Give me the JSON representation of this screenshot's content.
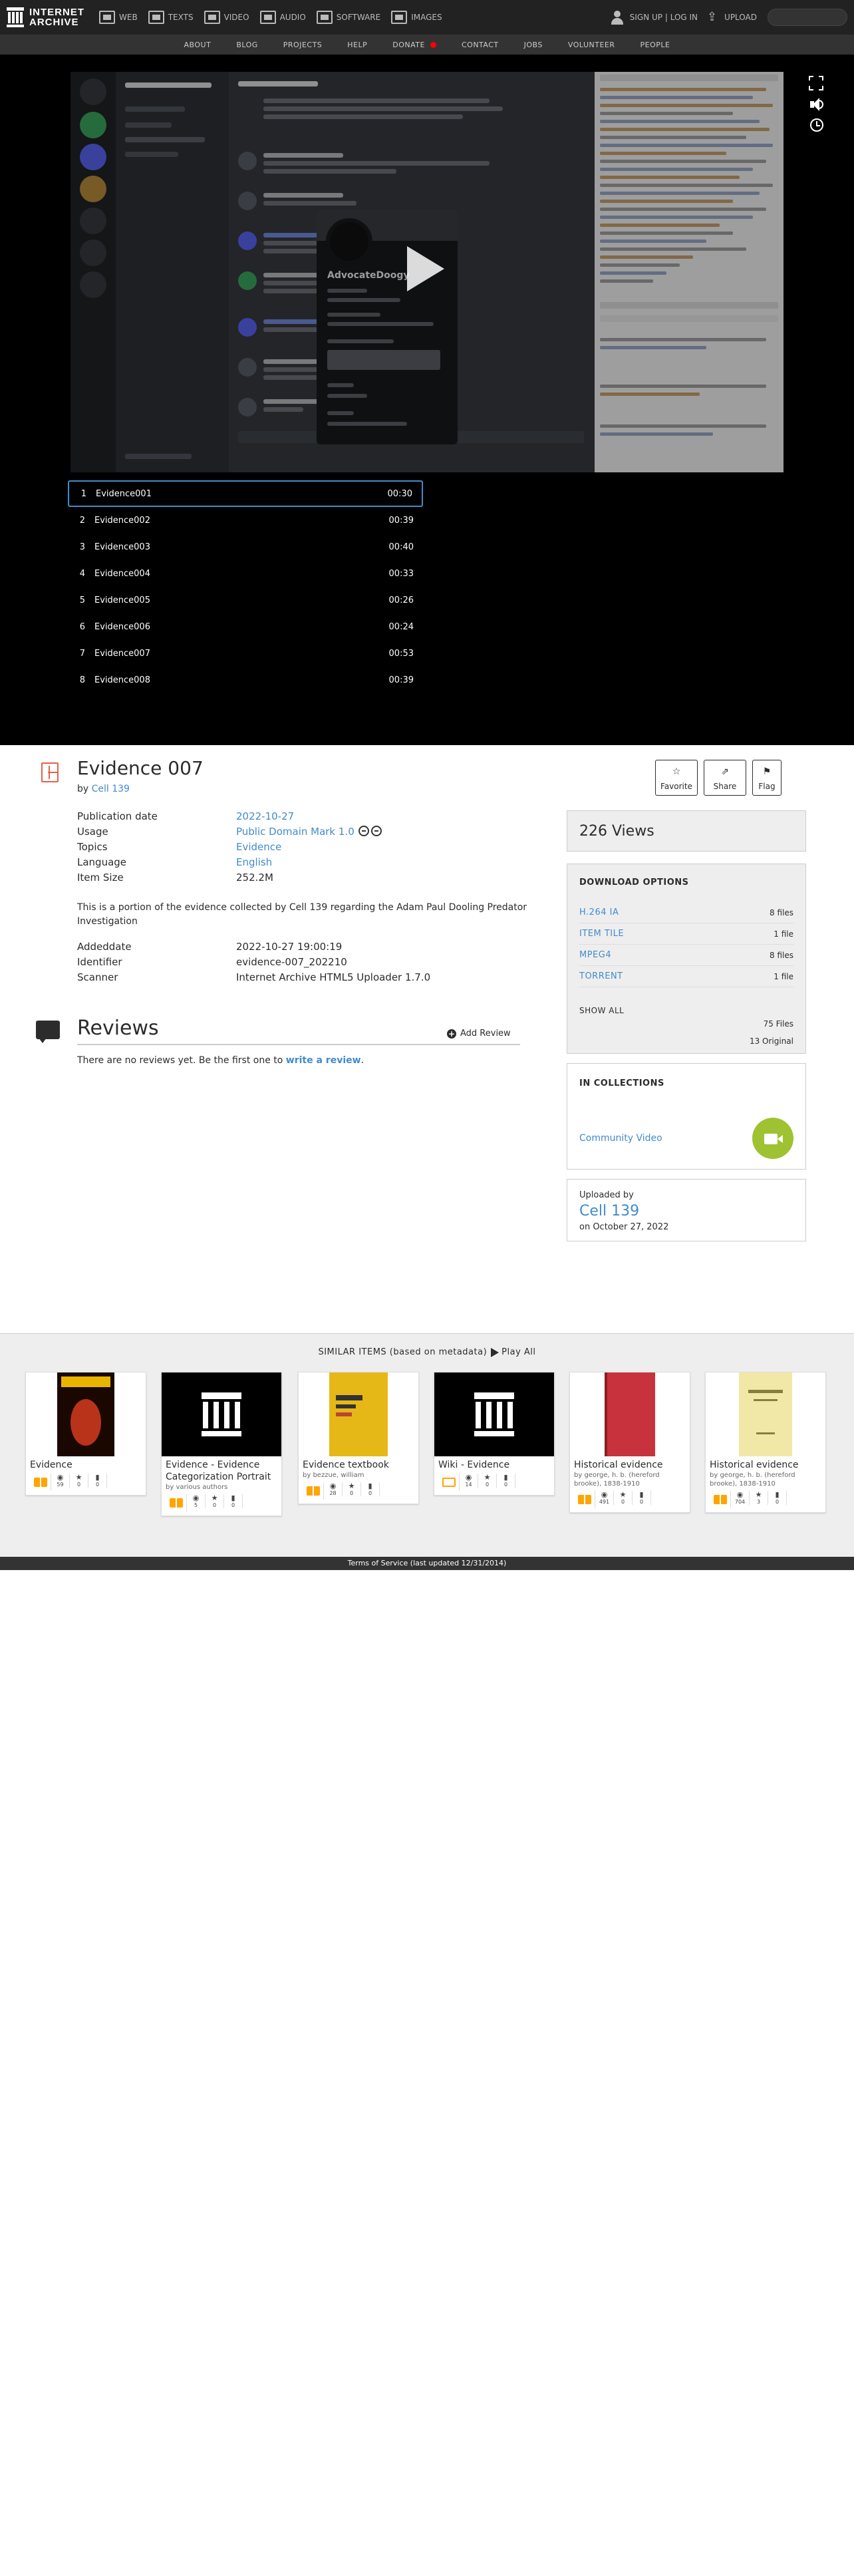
{
  "topnav": {
    "logo_line1": "INTERNET",
    "logo_line2": "ARCHIVE",
    "media_tabs": [
      {
        "label": "WEB",
        "icon": "web-icon"
      },
      {
        "label": "TEXTS",
        "icon": "texts-icon"
      },
      {
        "label": "VIDEO",
        "icon": "video-icon"
      },
      {
        "label": "AUDIO",
        "icon": "audio-icon"
      },
      {
        "label": "SOFTWARE",
        "icon": "software-icon"
      },
      {
        "label": "IMAGES",
        "icon": "images-icon"
      }
    ],
    "signin_label": "SIGN UP | LOG IN",
    "upload_label": "UPLOAD",
    "search_placeholder": ""
  },
  "secnav": {
    "items": [
      "ABOUT",
      "BLOG",
      "PROJECTS",
      "HELP",
      "DONATE",
      "CONTACT",
      "JOBS",
      "VOLUNTEER",
      "PEOPLE"
    ]
  },
  "player": {
    "screenshot_popup_name": "AdvocateDoogy"
  },
  "playlist": [
    {
      "num": "1",
      "title": "Evidence001",
      "duration": "00:30"
    },
    {
      "num": "2",
      "title": "Evidence002",
      "duration": "00:39"
    },
    {
      "num": "3",
      "title": "Evidence003",
      "duration": "00:40"
    },
    {
      "num": "4",
      "title": "Evidence004",
      "duration": "00:33"
    },
    {
      "num": "5",
      "title": "Evidence005",
      "duration": "00:26"
    },
    {
      "num": "6",
      "title": "Evidence006",
      "duration": "00:24"
    },
    {
      "num": "7",
      "title": "Evidence007",
      "duration": "00:53"
    },
    {
      "num": "8",
      "title": "Evidence008",
      "duration": "00:39"
    }
  ],
  "item": {
    "title": "Evidence 007",
    "by_prefix": "by",
    "creator": "Cell 139",
    "actions": {
      "favorite": "Favorite",
      "share": "Share",
      "flag": "Flag"
    },
    "metadata": [
      {
        "key": "Publication date",
        "value": "2022-10-27",
        "link": true
      },
      {
        "key": "Usage",
        "value": "Public Domain Mark 1.0",
        "link": true
      },
      {
        "key": "Topics",
        "value": "Evidence",
        "link": true
      },
      {
        "key": "Language",
        "value": "English",
        "link": true
      },
      {
        "key": "Item Size",
        "value": "252.2M",
        "link": false
      }
    ],
    "description": "This is a portion of the evidence collected by Cell 139 regarding the Adam Paul Dooling Predator Investigation",
    "metadata2": [
      {
        "key": "Addeddate",
        "value": "2022-10-27 19:00:19"
      },
      {
        "key": "Identifier",
        "value": "evidence-007_202210"
      },
      {
        "key": "Scanner",
        "value": "Internet Archive HTML5 Uploader 1.7.0"
      }
    ]
  },
  "reviews": {
    "title": "Reviews",
    "add_label": "Add Review",
    "empty_prefix": "There are no reviews yet. Be the first one to",
    "empty_link": "write a review",
    "empty_suffix": "."
  },
  "sidebar": {
    "views": "226 Views",
    "download_title": "DOWNLOAD OPTIONS",
    "downloads": [
      {
        "format": "H.264 IA",
        "count": "8 files"
      },
      {
        "format": "ITEM TILE",
        "count": "1 file"
      },
      {
        "format": "MPEG4",
        "count": "8 files"
      },
      {
        "format": "TORRENT",
        "count": "1 file"
      }
    ],
    "show_all": "SHOW ALL",
    "total_files": "75 Files",
    "original_files": "13 Original",
    "collections_title": "IN COLLECTIONS",
    "collection_name": "Community Video",
    "uploaded_by_label": "Uploaded by",
    "uploader": "Cell 139",
    "upload_date": "on October 27, 2022"
  },
  "similar": {
    "heading": "SIMILAR ITEMS (based on metadata)",
    "play_all": "Play All",
    "items": [
      {
        "title": "Evidence",
        "by": "",
        "type": "book",
        "thumb": "evidence-book",
        "stats": [
          "59",
          "0",
          "0"
        ]
      },
      {
        "title": "Evidence - Evidence Categorization Portrait",
        "by": "by various authors",
        "type": "book",
        "thumb": "ia-temple",
        "stats": [
          "5",
          "0",
          "0"
        ]
      },
      {
        "title": "Evidence textbook",
        "by": "by bezzue, william",
        "type": "book",
        "thumb": "textbook",
        "stats": [
          "28",
          "0",
          "0"
        ]
      },
      {
        "title": "Wiki - Evidence",
        "by": "",
        "type": "web",
        "thumb": "ia-temple",
        "stats": [
          "14",
          "0",
          "0"
        ]
      },
      {
        "title": "Historical evidence",
        "by": "by george, h. b. (hereford brooke), 1838-1910",
        "type": "book",
        "thumb": "red-book",
        "stats": [
          "491",
          "0",
          "0"
        ]
      },
      {
        "title": "Historical evidence",
        "by": "by george, h. b. (hereford brooke), 1838-1910",
        "type": "book",
        "thumb": "yellow-page",
        "stats": [
          "704",
          "3",
          "0"
        ]
      }
    ]
  },
  "footer": {
    "text": "Terms of Service (last updated 12/31/2014)"
  },
  "colors": {
    "link": "#428bca",
    "nav_bg": "#222222",
    "accent_red": "#e2614c",
    "collection_green": "#9ec231",
    "book_orange": "#ffa500"
  }
}
